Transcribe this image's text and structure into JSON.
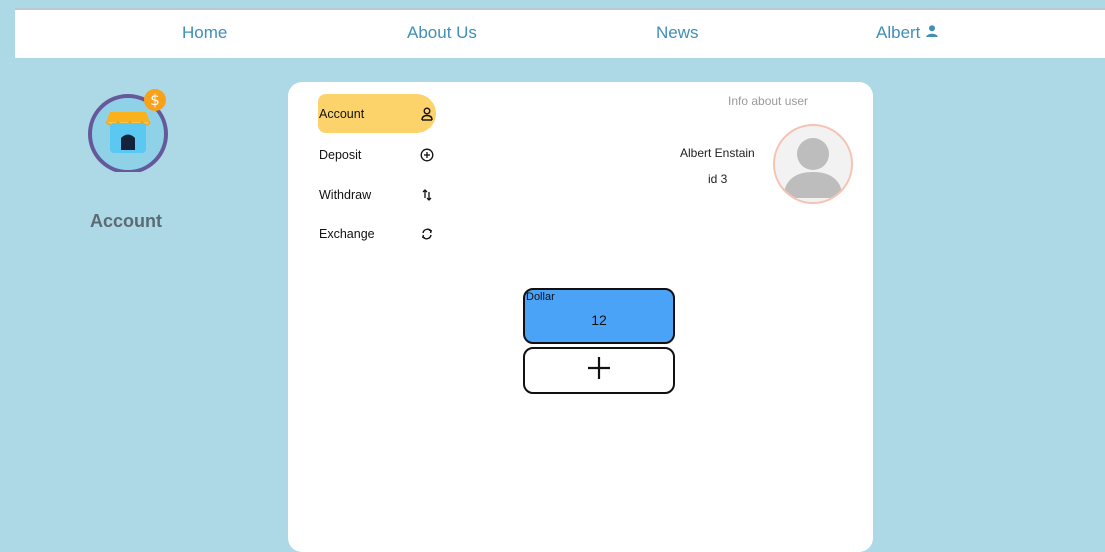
{
  "nav": {
    "home": "Home",
    "about": "About Us",
    "news": "News",
    "user": "Albert"
  },
  "left": {
    "title": "Account"
  },
  "menu": {
    "items": [
      {
        "label": "Account",
        "icon": "user-icon"
      },
      {
        "label": "Deposit",
        "icon": "plus-circle-icon"
      },
      {
        "label": "Withdraw",
        "icon": "arrows-up-down-icon"
      },
      {
        "label": "Exchange",
        "icon": "refresh-icon"
      }
    ]
  },
  "info": {
    "title": "Info about user",
    "name": "Albert Enstain",
    "id": "id 3"
  },
  "wallet": {
    "currency": "Dollar",
    "amount": "12"
  },
  "colors": {
    "background": "#add8e6",
    "nav_text": "#3f8fb8",
    "active_menu": "#fbd36a",
    "wallet": "#4aa3f7"
  }
}
